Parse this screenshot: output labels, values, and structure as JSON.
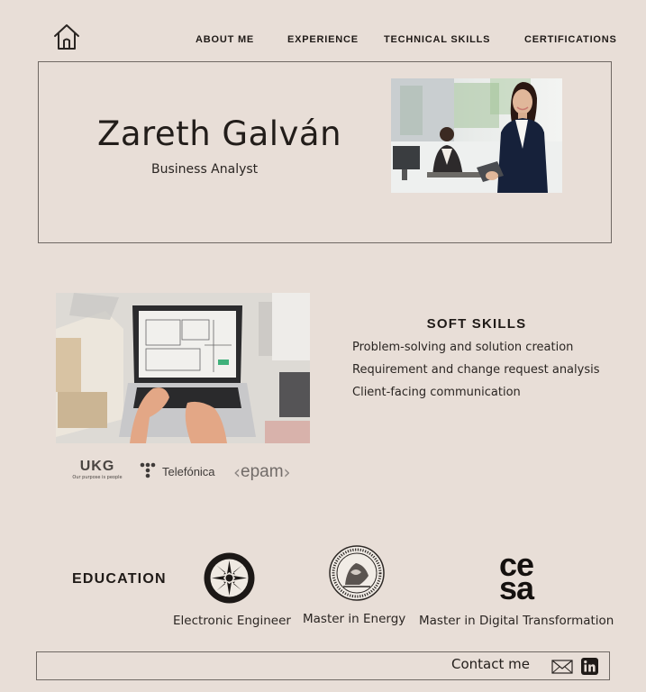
{
  "nav": {
    "items": [
      {
        "label": "ABOUT ME"
      },
      {
        "label": "EXPERIENCE"
      },
      {
        "label": "TECHNICAL SKILLS"
      },
      {
        "label": "CERTIFICATIONS"
      }
    ],
    "home_icon": "home-icon"
  },
  "hero": {
    "name": "Zareth Galván",
    "role": "Business Analyst"
  },
  "soft_skills": {
    "title": "SOFT SKILLS",
    "items": [
      "Problem-solving and solution creation",
      "Requirement and change request analysis",
      "Client-facing communication"
    ]
  },
  "companies": {
    "ukg": {
      "name": "UKG",
      "tagline": "Our purpose is people"
    },
    "telefonica": {
      "name": "Telefónica"
    },
    "epam": {
      "name": "epam"
    }
  },
  "education": {
    "title": "EDUCATION",
    "items": [
      {
        "label": "Electronic Engineer"
      },
      {
        "label": "Master in Energy"
      },
      {
        "label": "Master in Digital Transformation",
        "logo_text": "cesa"
      }
    ]
  },
  "footer": {
    "contact_label": "Contact me",
    "icons": [
      "mail-icon",
      "linkedin-icon"
    ]
  },
  "colors": {
    "background": "#e8ded7",
    "text": "#221d1a",
    "border": "#6f6863"
  }
}
